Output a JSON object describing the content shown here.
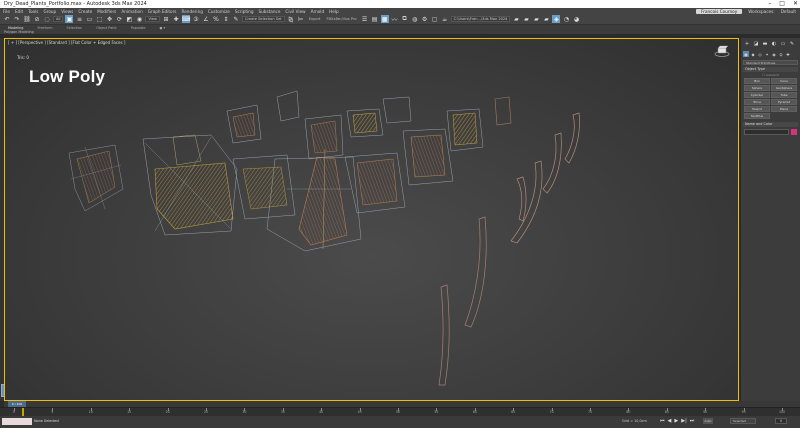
{
  "window": {
    "title": "Dry_Dead_Plants_Portfolio.max - Autodesk 3ds Max 2024",
    "minimize": "–",
    "maximize": "□",
    "close": "✕"
  },
  "menu": {
    "items": [
      "File",
      "Edit",
      "Tools",
      "Group",
      "Views",
      "Create",
      "Modifiers",
      "Animation",
      "Graph Editors",
      "Rendering",
      "Customize",
      "Scripting",
      "Substance",
      "Civil View",
      "Arnold",
      "Help"
    ],
    "account": "Francois Cournoy",
    "workspaces_label": "Workspaces:",
    "workspace_value": "Default"
  },
  "toolbar": {
    "filter_value": "All",
    "view_value": "View",
    "selection_set": "Create Selection Set",
    "export_label": "Export",
    "render_mode": "FBXx8e:/Illus Pro",
    "project_path": "C:\\Users\\Fran...\\3ds Max 2024"
  },
  "ribbon": {
    "tabs": [
      "Modeling",
      "Freeform",
      "Selection",
      "Object Paint",
      "Populate",
      "●  ▾"
    ],
    "active_tab": "Modeling",
    "subpanel": "Polygon Modeling"
  },
  "viewport": {
    "label": "[ + ] [Perspective ] [Standard ] [Flat Color + Edged Faces ]",
    "tris_label": "Tris:",
    "tris_value": "0",
    "overlay_title": "Low Poly"
  },
  "command_panel": {
    "tabs": [
      "+",
      "◪",
      "▬",
      "◐",
      "▭",
      "✎"
    ],
    "category_icons": [
      "●",
      "◆",
      "◎",
      "✦",
      "◉",
      "⛭",
      "✚"
    ],
    "dropdown": "Standard Primitives",
    "object_type_header": "Object Type",
    "autogrid": "☐ AutoGrid",
    "object_buttons": [
      "Box",
      "Cone",
      "Sphere",
      "GeoSphere",
      "Cylinder",
      "Tube",
      "Torus",
      "Pyramid",
      "Teapot",
      "Plane",
      "TextPlus",
      ""
    ],
    "name_color_header": "Name and Color"
  },
  "timeline": {
    "slider_label": "0 / 100",
    "ticks": [
      "0",
      "5",
      "10",
      "15",
      "20",
      "25",
      "30",
      "35",
      "40",
      "45",
      "50",
      "55",
      "60",
      "65",
      "70",
      "75",
      "80",
      "85",
      "90",
      "95",
      "100"
    ],
    "current_frame": 0
  },
  "status": {
    "selection": "None Selected",
    "grid": "Grid = 10,0cm",
    "auto_label": "Auto",
    "selected_dropdown": "Selected",
    "frame_value": "0",
    "playback": [
      "⏮",
      "◀",
      "▶",
      "▶|",
      "⏭"
    ]
  },
  "colors": {
    "viewport_border": "#f0c000",
    "active_blue": "#6b9ec7",
    "swatch": "#d7337a",
    "mesh_orange": "#c89a4a",
    "mesh_wire": "#b9a46e"
  }
}
